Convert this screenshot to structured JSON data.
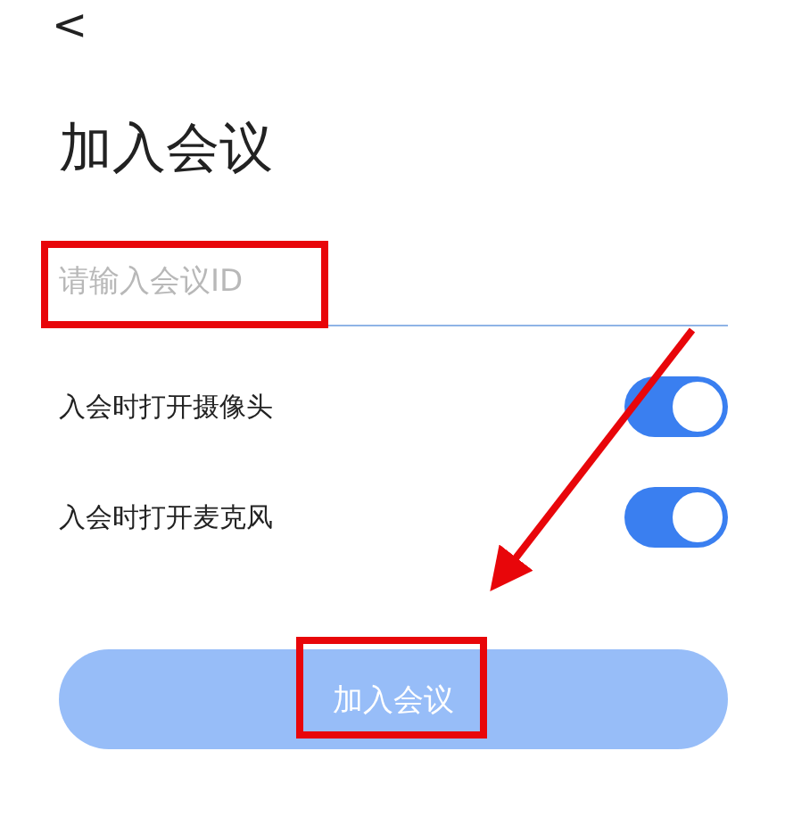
{
  "back": {
    "glyph": "<"
  },
  "title": "加入会议",
  "meeting_id": {
    "placeholder": "请输入会议ID"
  },
  "options": [
    {
      "label": "入会时打开摄像头",
      "on": true
    },
    {
      "label": "入会时打开麦克风",
      "on": true
    }
  ],
  "join_button": {
    "label": "加入会议",
    "disabled": true
  }
}
